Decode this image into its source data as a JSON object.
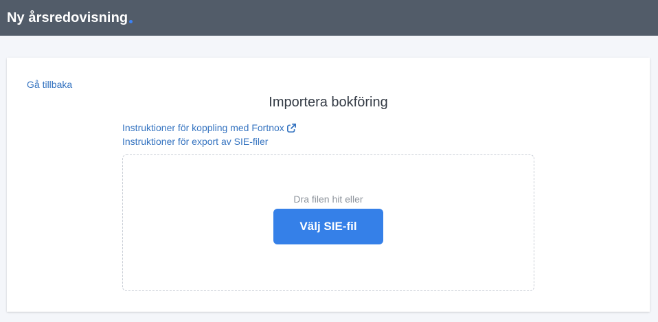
{
  "header": {
    "brand": "Ny årsredovisning",
    "brand_dot_color": "#3b82f6",
    "background_color": "#525c69"
  },
  "colors": {
    "link": "#3473c0",
    "button": "#3580e8"
  },
  "main": {
    "back_link": "Gå tillbaka",
    "title": "Importera bokföring",
    "links": [
      {
        "label": "Instruktioner för koppling med Fortnox",
        "icon": "external-link-icon"
      },
      {
        "label": "Instruktioner för export av SIE-filer"
      }
    ],
    "dropzone": {
      "hint": "Dra filen hit eller",
      "button_label": "Välj SIE-fil"
    }
  }
}
